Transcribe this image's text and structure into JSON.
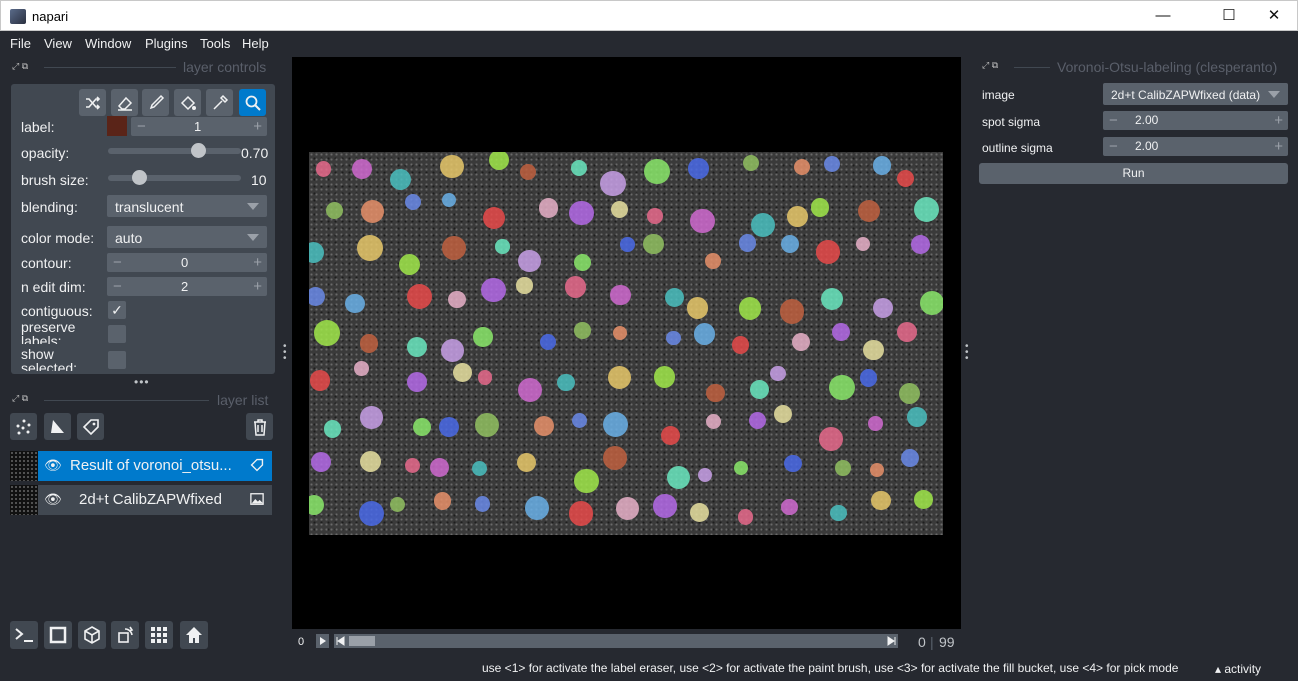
{
  "window": {
    "title": "napari",
    "minimize": "—",
    "maximize": "☐",
    "close": "✕"
  },
  "menu": [
    "File",
    "View",
    "Window",
    "Plugins",
    "Tools",
    "Help"
  ],
  "layer_controls": {
    "header": "layer controls",
    "label_label": "label:",
    "label_value": "1",
    "label_color": "#5a2418",
    "opacity_label": "opacity:",
    "opacity_value": "0.70",
    "opacity_fraction": 0.7,
    "brush_size_label": "brush size:",
    "brush_size_value": "10",
    "brush_size_fraction": 0.2,
    "blending_label": "blending:",
    "blending_value": "translucent",
    "color_mode_label": "color mode:",
    "color_mode_value": "auto",
    "contour_label": "contour:",
    "contour_value": "0",
    "n_edit_dim_label": "n edit dim:",
    "n_edit_dim_value": "2",
    "contiguous_label": "contiguous:",
    "contiguous_checked": true,
    "preserve_labels_label": "preserve labels:",
    "show_selected_label": "show selected:"
  },
  "layer_list": {
    "header": "layer list",
    "layers": [
      {
        "name": "Result of voronoi_otsu...",
        "type_icon": "label-icon",
        "selected": true
      },
      {
        "name": "2d+t CalibZAPWfixed",
        "type_icon": "image-icon",
        "selected": false
      }
    ]
  },
  "dims": {
    "start": "0",
    "current": "0",
    "max": "99"
  },
  "plugin": {
    "header": "Voronoi-Otsu-labeling (clesperanto)",
    "image_label": "image",
    "image_value": "2d+t CalibZAPWfixed (data)",
    "spot_sigma_label": "spot sigma",
    "spot_sigma_value": "2.00",
    "outline_sigma_label": "outline sigma",
    "outline_sigma_value": "2.00",
    "run_label": "Run"
  },
  "status": {
    "message": "use <1> for activate the label eraser, use <2> for activate the paint brush, use <3> for activate the fill bucket, use <4> for pick mode",
    "activity": "activity"
  },
  "colors": {
    "accent": "#007acc",
    "background": "#262930",
    "panel": "#414851"
  }
}
